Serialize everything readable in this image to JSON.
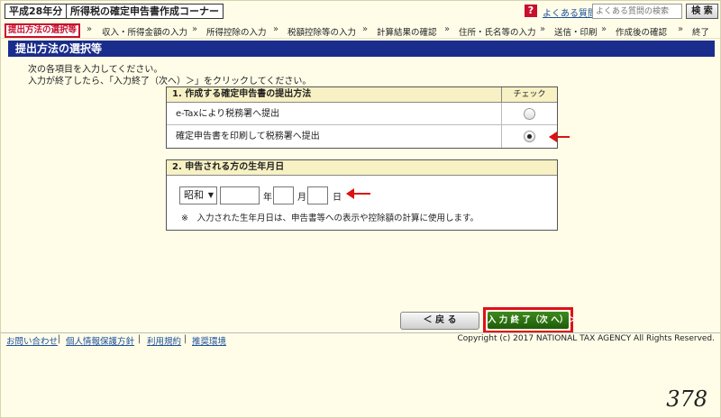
{
  "header": {
    "year_badge": "平成28年分",
    "corner_title": "所得税の確定申告書作成コーナー",
    "help_icon": "?",
    "faq_link": "よくある質問",
    "search_placeholder": "よくある質問の検索",
    "search_button": "検 索"
  },
  "steps": [
    "提出方法の選択等",
    "収入・所得金額の入力",
    "所得控除の入力",
    "税額控除等の入力",
    "計算結果の確認",
    "住所・氏名等の入力",
    "送信・印刷",
    "作成後の確認",
    "終了"
  ],
  "step_separator": "»",
  "section_title": "提出方法の選択等",
  "instructions": [
    "次の各項目を入力してください。",
    "入力が終了したら、「入力終了（次へ）＞」をクリックしてください。"
  ],
  "submission": {
    "heading": "1. 作成する確定申告書の提出方法",
    "check_heading": "チェック",
    "options": [
      {
        "label": "e-Taxにより税務署へ提出",
        "selected": false
      },
      {
        "label": "確定申告書を印刷して税務署へ提出",
        "selected": true
      }
    ]
  },
  "birthdate": {
    "heading": "2. 申告される方の生年月日",
    "era_value": "昭和",
    "era_caret": "▼",
    "year_value": "",
    "year_unit": "年",
    "month_value": "",
    "month_unit": "月",
    "day_value": "",
    "day_unit": "日",
    "note": "※　入力された生年月日は、申告書等への表示や控除額の計算に使用します。"
  },
  "buttons": {
    "back": "＜ 戻 る",
    "next": "入 力 終 了（次 へ）＞"
  },
  "footer": {
    "links": [
      "お問い合わせ",
      "個人情報保護方針",
      "利用規約",
      "推奨環境"
    ],
    "separator": "|",
    "copyright": "Copyright (c) 2017 NATIONAL TAX AGENCY All Rights Reserved."
  },
  "page_number": "378",
  "colors": {
    "accent_red": "#e0101a",
    "header_navy": "#1b2d8c",
    "next_green": "#2f7a14",
    "page_bg": "#fffde8"
  }
}
